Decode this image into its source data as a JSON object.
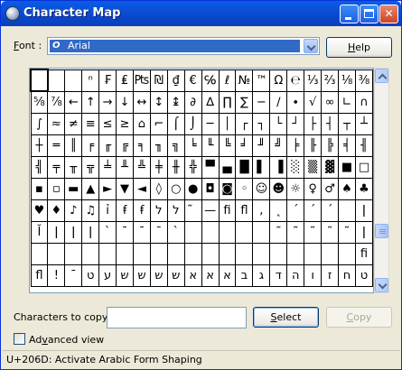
{
  "window": {
    "title": "Character Map"
  },
  "font": {
    "label_prefix": "F",
    "label_rest": "ont :",
    "selected": "Arial",
    "font_icon_glyph": "O"
  },
  "help_button": {
    "prefix": "H",
    "rest": "elp"
  },
  "grid": {
    "rows": [
      [
        "",
        "",
        "",
        "ⁿ",
        "₣",
        "₤",
        "₧",
        "₪",
        "₫",
        "€",
        "℅",
        "ℓ",
        "№",
        "™",
        "Ω",
        "℮",
        "⅓",
        "⅔",
        "⅛",
        "⅜"
      ],
      [
        "⅝",
        "⅞",
        "←",
        "↑",
        "→",
        "↓",
        "↔",
        "↕",
        "↨",
        "∂",
        "∆",
        "∏",
        "∑",
        "−",
        "∕",
        "∙",
        "√",
        "∞",
        "∟",
        "∩"
      ],
      [
        "∫",
        "≈",
        "≠",
        "≡",
        "≤",
        "≥",
        "⌂",
        "⌐",
        "⌠",
        "⌡",
        "─",
        "│",
        "┌",
        "┐",
        "└",
        "┘",
        "├",
        "┤",
        "┬",
        "┴"
      ],
      [
        "┼",
        "═",
        "║",
        "╒",
        "╓",
        "╔",
        "╕",
        "╖",
        "╗",
        "╘",
        "╙",
        "╚",
        "╛",
        "╜",
        "╝",
        "╞",
        "╟",
        "╠",
        "╡",
        "╢"
      ],
      [
        "╣",
        "╤",
        "╥",
        "╦",
        "╧",
        "╨",
        "╩",
        "╪",
        "╫",
        "╬",
        "▀",
        "▄",
        "█",
        "▌",
        "▐",
        "░",
        "▒",
        "▓",
        "■",
        "□"
      ],
      [
        "▪",
        "▫",
        "▬",
        "▲",
        "►",
        "▼",
        "◄",
        "◊",
        "○",
        "●",
        "◘",
        "◙",
        "◦",
        "☺",
        "☻",
        "☼",
        "♀",
        "♂",
        "♠",
        "♣"
      ],
      [
        "♥",
        "♦",
        "♪",
        "♫",
        "ỉ",
        "ꞙ",
        "ꞙ",
        "ל",
        "ל",
        "̃",
        "—",
        "ﬁ",
        "ﬂ",
        ",",
        "˛",
        "´",
        "´",
        "´",
        "",
        "ǀ"
      ],
      [
        "Ĭ",
        "ǀ",
        "ǀ",
        "ǀ",
        "ˋ",
        "ˉ",
        "ˉ",
        "ˉ",
        "ˋ",
        "",
        "",
        "",
        "",
        "",
        "˜",
        "˜",
        "˜",
        "˜",
        "˜",
        "ǀ"
      ],
      [
        "",
        "",
        "",
        "",
        "",
        "",
        "",
        "",
        "",
        "",
        "",
        "",
        "",
        "",
        "",
        "",
        "",
        "",
        "",
        "ﬁ"
      ],
      [
        "ﬂ",
        "!",
        "ˉ",
        "ט",
        "ע",
        "ש",
        "ש",
        "ש",
        "ש",
        "א",
        "א",
        "א",
        "ב",
        "ג",
        "ד",
        "ה",
        "ו",
        "ז",
        "ח",
        "ט"
      ]
    ]
  },
  "characters_to_copy": {
    "label": "Characters to copy :",
    "value": "",
    "select_prefix": "S",
    "select_rest": "elect",
    "copy_prefix": "C",
    "copy_rest": "opy"
  },
  "advanced_view": {
    "prefix": "Ad",
    "underlined": "v",
    "rest": "anced view",
    "checked": false
  },
  "status_bar": {
    "text": "U+206D: Activate Arabic Form Shaping"
  },
  "colors": {
    "titlebar": "#0a5ce6",
    "selection": "#316ac5",
    "window_bg": "#ece9d8"
  }
}
